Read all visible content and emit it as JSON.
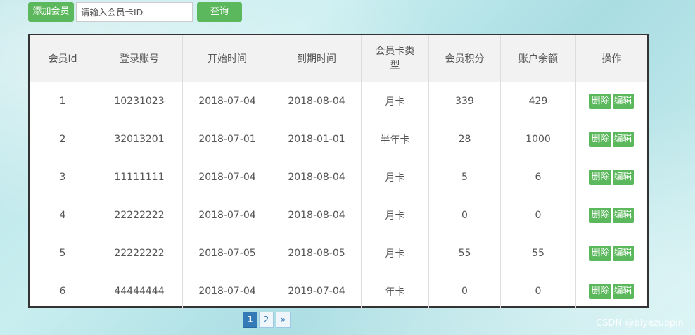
{
  "toolbar": {
    "add_label": "添加会员",
    "search_placeholder": "请输入会员卡ID",
    "search_value": "",
    "query_label": "查询"
  },
  "table": {
    "columns": [
      "会员Id",
      "登录账号",
      "开始时间",
      "到期时间",
      "会员卡类型",
      "会员积分",
      "账户余额",
      "操作"
    ],
    "rows": [
      {
        "id": "1",
        "account": "10231023",
        "start": "2018-07-04",
        "end": "2018-08-04",
        "type": "月卡",
        "points": "339",
        "balance": "429"
      },
      {
        "id": "2",
        "account": "32013201",
        "start": "2018-07-01",
        "end": "2018-01-01",
        "type": "半年卡",
        "points": "28",
        "balance": "1000"
      },
      {
        "id": "3",
        "account": "11111111",
        "start": "2018-07-04",
        "end": "2018-08-04",
        "type": "月卡",
        "points": "5",
        "balance": "6"
      },
      {
        "id": "4",
        "account": "22222222",
        "start": "2018-07-04",
        "end": "2018-08-04",
        "type": "月卡",
        "points": "0",
        "balance": "0"
      },
      {
        "id": "5",
        "account": "22222222",
        "start": "2018-07-05",
        "end": "2018-08-05",
        "type": "月卡",
        "points": "55",
        "balance": "55"
      },
      {
        "id": "6",
        "account": "44444444",
        "start": "2018-07-04",
        "end": "2019-07-04",
        "type": "年卡",
        "points": "0",
        "balance": "0"
      }
    ],
    "delete_label": "删除",
    "edit_label": "编辑"
  },
  "pagination": {
    "pages": [
      "1",
      "2"
    ],
    "active_page": "1",
    "next_label": "»"
  },
  "watermark": "CSDN @biyezuopin",
  "colors": {
    "button_green": "#5cb85c",
    "pagination_active": "#337ab7",
    "header_bg": "#f2f2f2"
  }
}
